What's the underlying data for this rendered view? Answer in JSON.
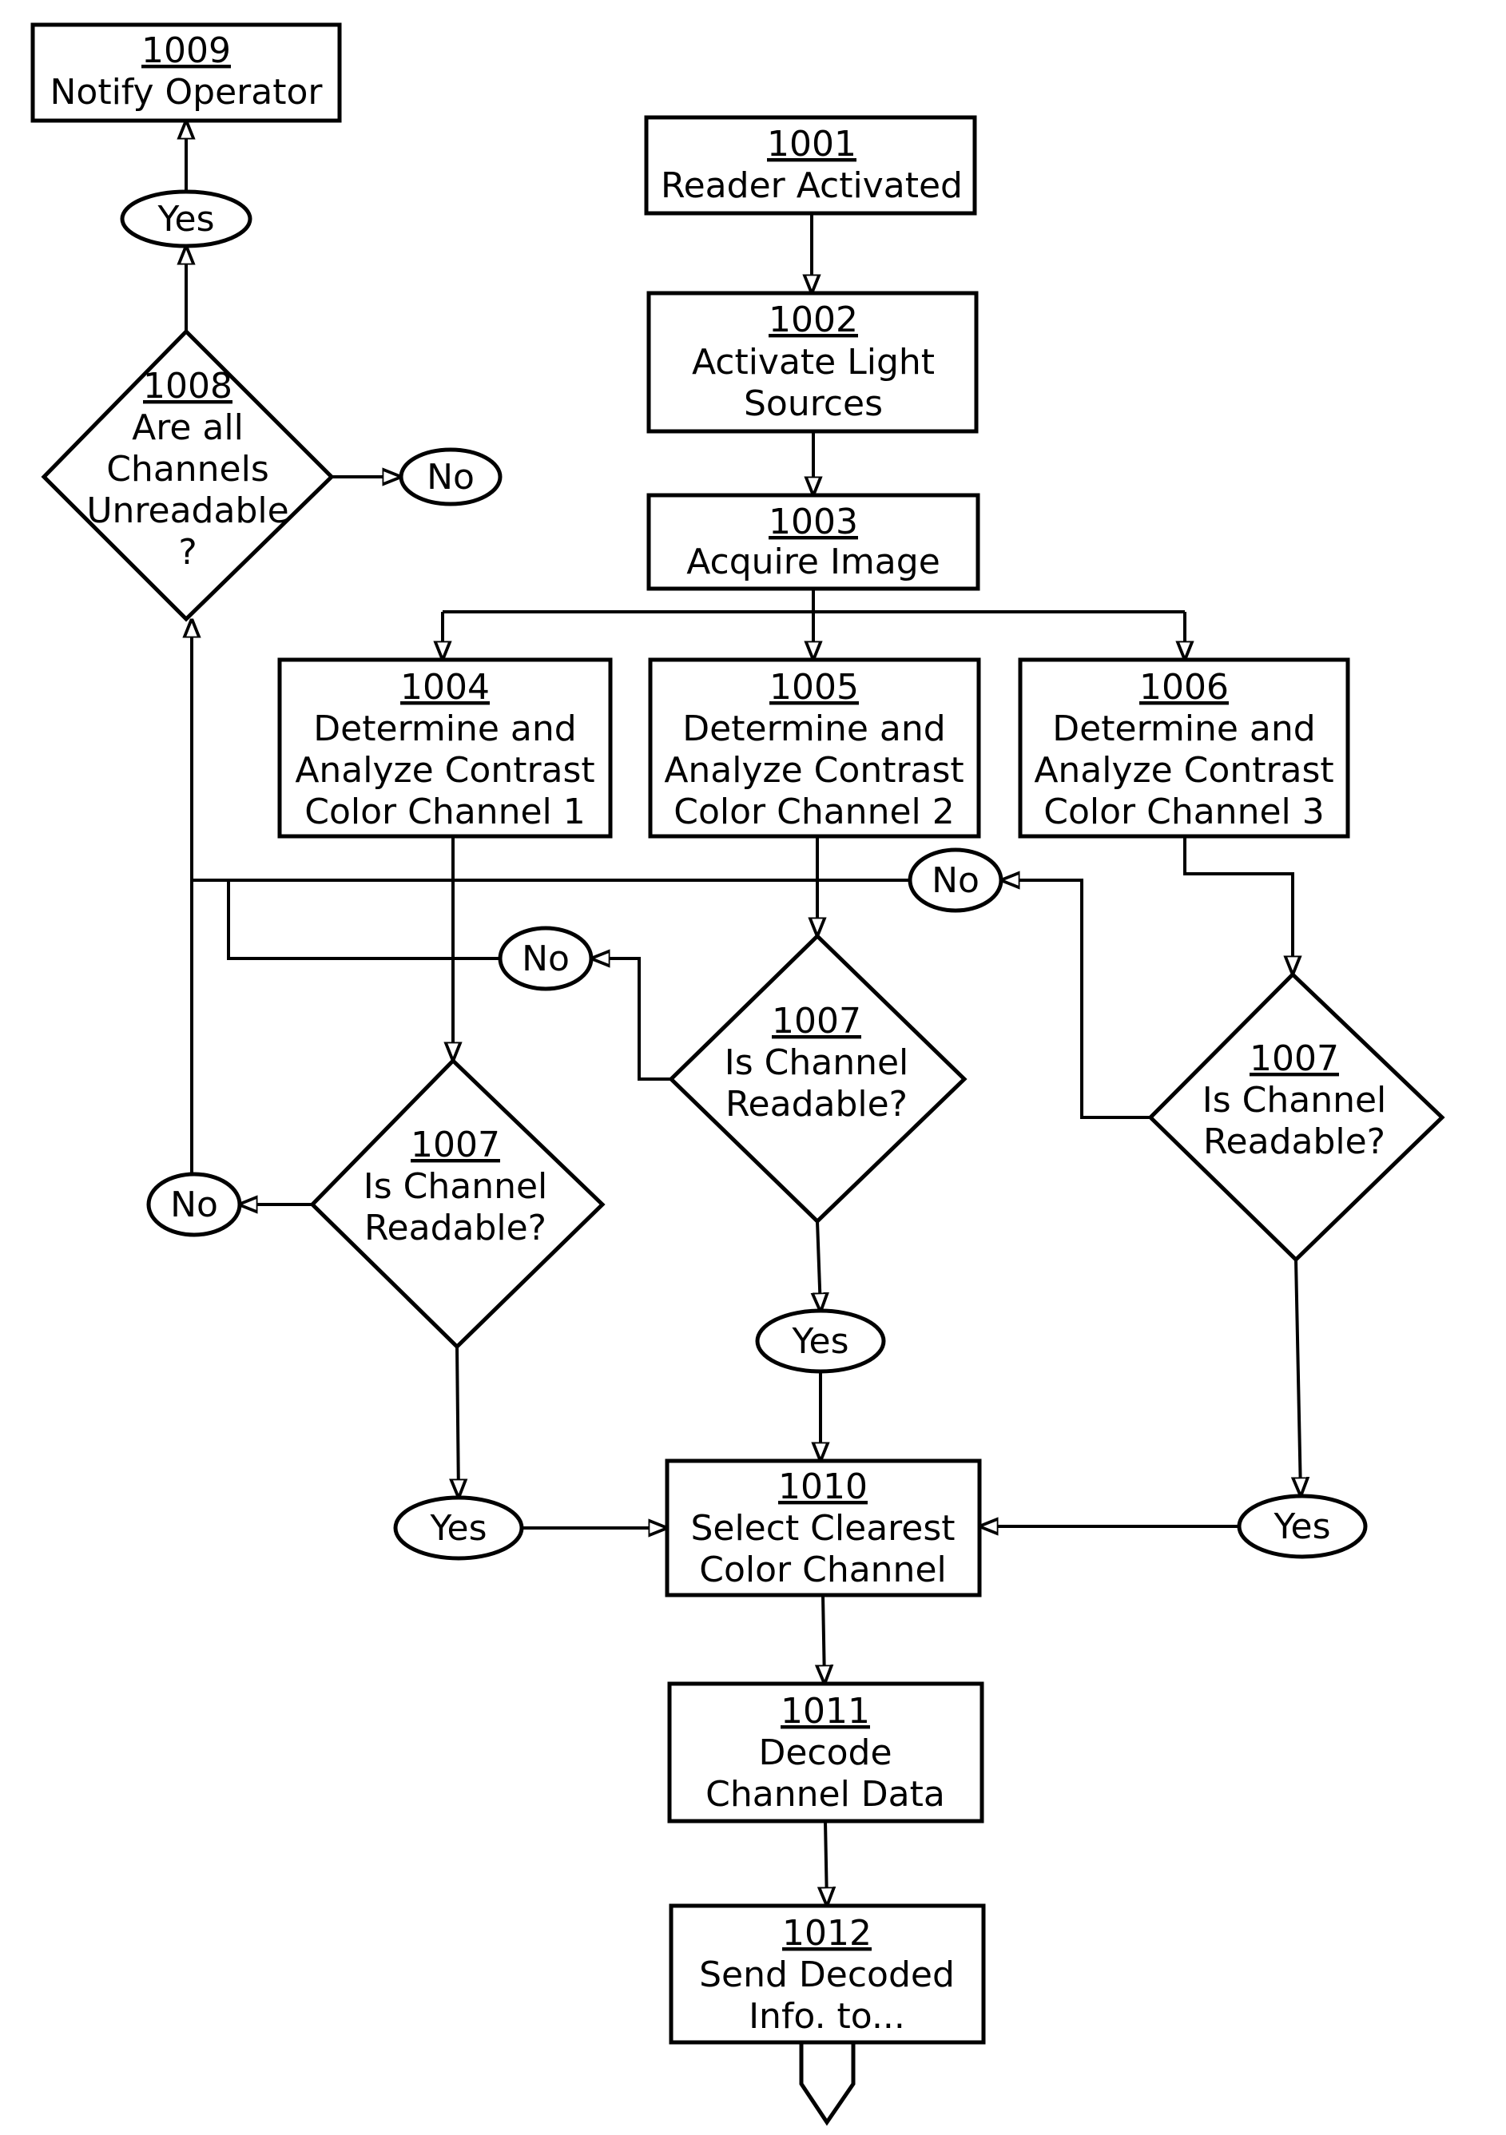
{
  "diagram": {
    "type": "flowchart",
    "colors": {
      "stroke": "#000000",
      "background": "#ffffff"
    },
    "nodes": {
      "n1001": {
        "id": "1001",
        "lines": [
          "Reader Activated"
        ]
      },
      "n1002": {
        "id": "1002",
        "lines": [
          "Activate Light",
          "Sources"
        ]
      },
      "n1003": {
        "id": "1003",
        "lines": [
          "Acquire Image"
        ]
      },
      "n1004": {
        "id": "1004",
        "lines": [
          "Determine and",
          "Analyze Contrast",
          "Color Channel 1"
        ]
      },
      "n1005": {
        "id": "1005",
        "lines": [
          "Determine and",
          "Analyze Contrast",
          "Color Channel 2"
        ]
      },
      "n1006": {
        "id": "1006",
        "lines": [
          "Determine and",
          "Analyze Contrast",
          "Color Channel 3"
        ]
      },
      "d1007a": {
        "id": "1007",
        "lines": [
          "Is Channel",
          "Readable?"
        ]
      },
      "d1007b": {
        "id": "1007",
        "lines": [
          "Is Channel",
          "Readable?"
        ]
      },
      "d1007c": {
        "id": "1007",
        "lines": [
          "Is Channel",
          "Readable?"
        ]
      },
      "d1008": {
        "id": "1008",
        "lines": [
          "Are all",
          "Channels",
          "Unreadable",
          "?"
        ]
      },
      "n1009": {
        "id": "1009",
        "lines": [
          "Notify Operator"
        ]
      },
      "n1010": {
        "id": "1010",
        "lines": [
          "Select Clearest",
          "Color Channel"
        ]
      },
      "n1011": {
        "id": "1011",
        "lines": [
          "Decode",
          "Channel Data"
        ]
      },
      "n1012": {
        "id": "1012",
        "lines": [
          "Send Decoded",
          "Info. to..."
        ]
      }
    },
    "labels": {
      "yes": "Yes",
      "no": "No"
    },
    "edges": [
      {
        "from": "1001",
        "to": "1002"
      },
      {
        "from": "1002",
        "to": "1003"
      },
      {
        "from": "1003",
        "to": "1004"
      },
      {
        "from": "1003",
        "to": "1005"
      },
      {
        "from": "1003",
        "to": "1006"
      },
      {
        "from": "1004",
        "to": "1007 (channel 1)"
      },
      {
        "from": "1005",
        "to": "1007 (channel 2)"
      },
      {
        "from": "1006",
        "to": "1007 (channel 3)"
      },
      {
        "from": "1007 (channel 1)",
        "label": "Yes",
        "to": "1010"
      },
      {
        "from": "1007 (channel 2)",
        "label": "Yes",
        "to": "1010"
      },
      {
        "from": "1007 (channel 3)",
        "label": "Yes",
        "to": "1010"
      },
      {
        "from": "1007 (channel 1)",
        "label": "No",
        "to": "1008"
      },
      {
        "from": "1007 (channel 2)",
        "label": "No",
        "to": "1008"
      },
      {
        "from": "1007 (channel 3)",
        "label": "No",
        "to": "1008"
      },
      {
        "from": "1008",
        "label": "Yes",
        "to": "1009"
      },
      {
        "from": "1008",
        "label": "No",
        "to": ""
      },
      {
        "from": "1010",
        "to": "1011"
      },
      {
        "from": "1011",
        "to": "1012"
      },
      {
        "from": "1012",
        "to": "off-page connector"
      }
    ]
  }
}
